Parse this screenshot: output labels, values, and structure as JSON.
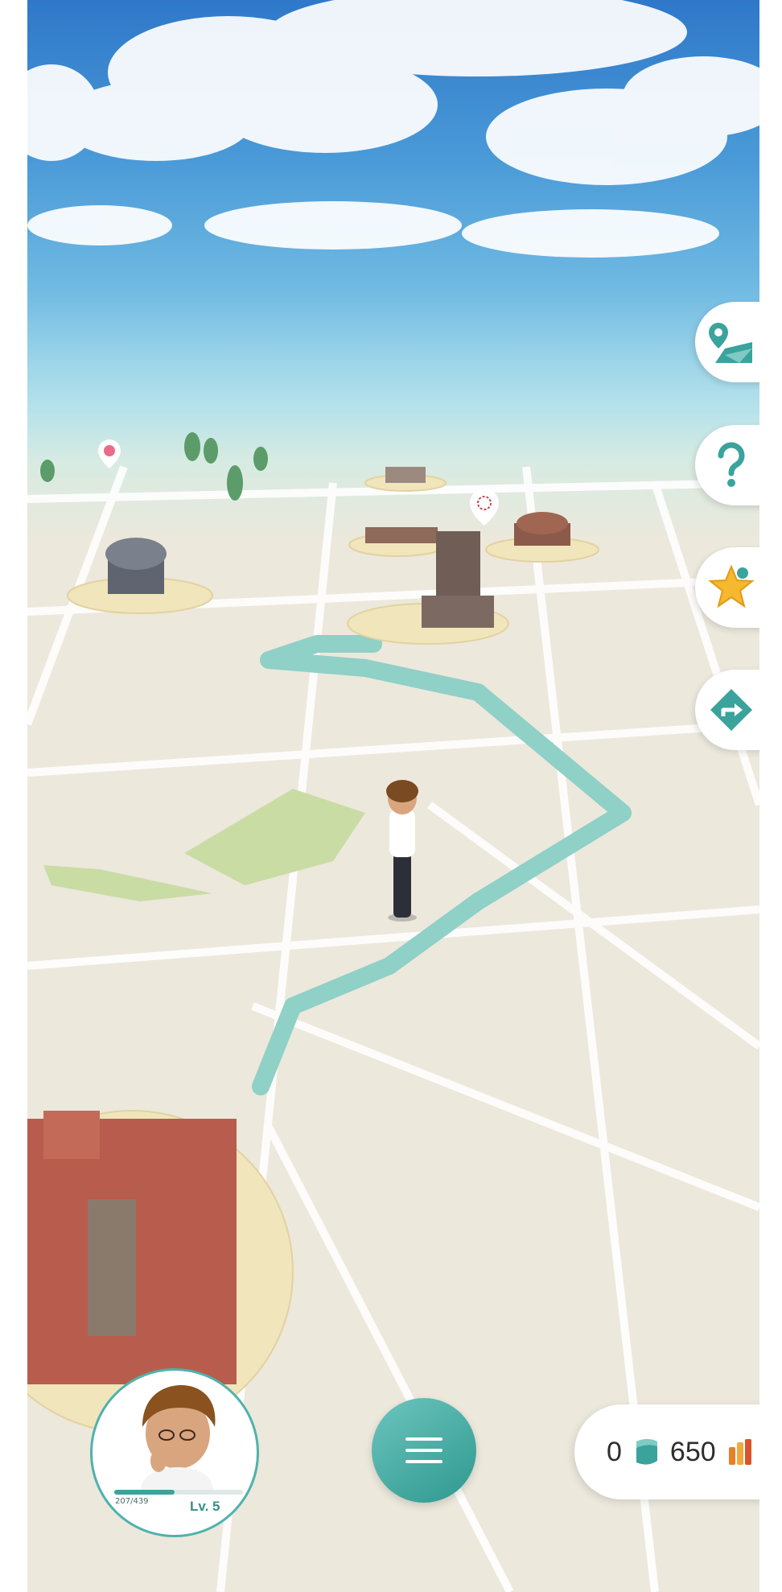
{
  "side_buttons": [
    {
      "icon": "map-location-icon"
    },
    {
      "icon": "help-question-icon"
    },
    {
      "icon": "star-icon"
    },
    {
      "icon": "route-direction-icon"
    }
  ],
  "profile": {
    "xp_text": "207/439",
    "xp_fraction": 0.47,
    "level": "Lv. 5"
  },
  "menu": {
    "icon": "hamburger-menu-icon"
  },
  "currency": {
    "tickets": "0",
    "coins": "650"
  },
  "colors": {
    "accent": "#3aa39c",
    "route": "#8fd0c7",
    "map_bg": "#ece8dc",
    "sky_top": "#2f78c9"
  }
}
